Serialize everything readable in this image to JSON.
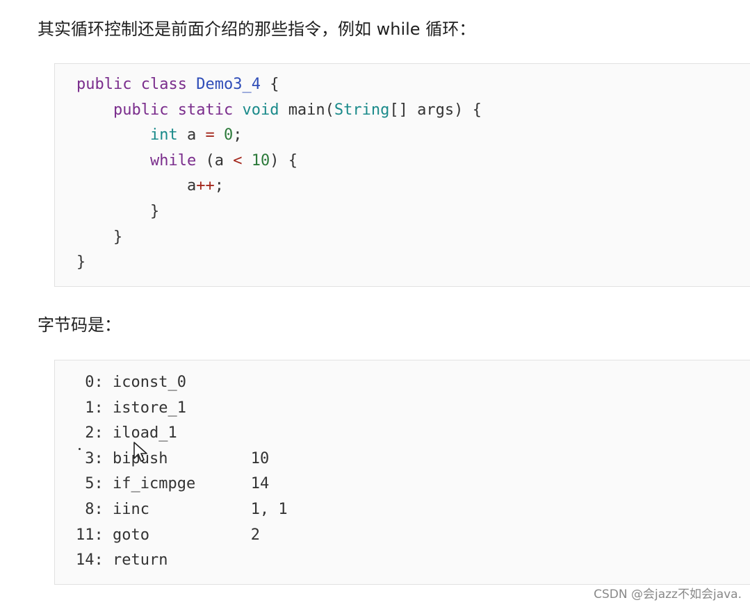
{
  "intro_text": "其实循环控制还是前面介绍的那些指令，例如 while 循环：",
  "source_code": {
    "line1": {
      "kw1": "public",
      "kw2": "class",
      "classname": "Demo3_4",
      "brace": "{"
    },
    "line2": {
      "kw1": "public",
      "kw2": "static",
      "type": "void",
      "method": "main(",
      "argtype": "String",
      "rest": "[] args) {"
    },
    "line3": {
      "type": "int",
      "var": "a",
      "eq": "=",
      "value": "0",
      "semi": ";"
    },
    "line4": {
      "kw": "while",
      "open": "(a",
      "op": "<",
      "value": "10",
      "close": ") {"
    },
    "line5": {
      "var": "a",
      "op": "++",
      "semi": ";"
    },
    "line6": "}",
    "line7": "}",
    "line8": "}"
  },
  "bytecode_heading": "字节码是：",
  "bytecode": [
    {
      "index": " 0:",
      "instr": "iconst_0",
      "arg": ""
    },
    {
      "index": " 1:",
      "instr": "istore_1",
      "arg": ""
    },
    {
      "index": " 2:",
      "instr": "iload_1",
      "arg": ""
    },
    {
      "index": " 3:",
      "instr": "bipush",
      "arg": "10"
    },
    {
      "index": " 5:",
      "instr": "if_icmpge",
      "arg": "14"
    },
    {
      "index": " 8:",
      "instr": "iinc",
      "arg": "1, 1"
    },
    {
      "index": "11:",
      "instr": "goto",
      "arg": "2"
    },
    {
      "index": "14:",
      "instr": "return",
      "arg": ""
    }
  ],
  "watermark": "CSDN @会jazz不如会java."
}
